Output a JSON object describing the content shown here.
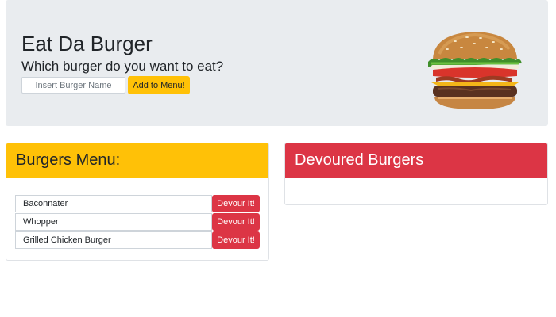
{
  "header": {
    "title": "Eat Da Burger",
    "subtitle": "Which burger do you want to eat?",
    "input_placeholder": "Insert Burger Name",
    "add_button": "Add to Menu!"
  },
  "menu": {
    "title": "Burgers Menu:",
    "items": [
      {
        "name": "Baconnater",
        "button": "Devour It!"
      },
      {
        "name": "Whopper",
        "button": "Devour It!"
      },
      {
        "name": "Grilled Chicken Burger",
        "button": "Devour It!"
      }
    ]
  },
  "devoured": {
    "title": "Devoured Burgers",
    "items": []
  },
  "colors": {
    "jumbotron_bg": "#e9ecef",
    "warning": "#ffc107",
    "danger": "#dc3545"
  }
}
